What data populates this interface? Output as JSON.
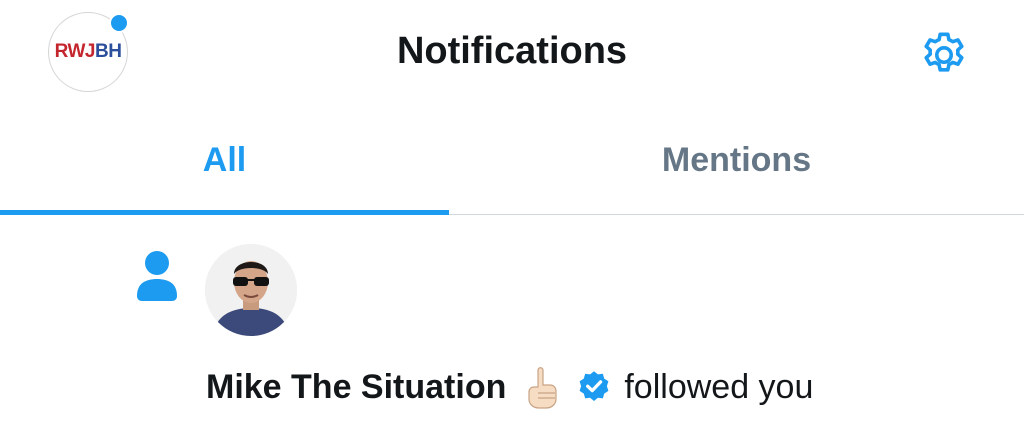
{
  "header": {
    "title": "Notifications",
    "profile_logo": {
      "part1": "RWJ",
      "part2": "BH"
    },
    "has_unread_indicator": true,
    "settings_icon": "gear-icon"
  },
  "tabs": [
    {
      "label": "All",
      "active": true
    },
    {
      "label": "Mentions",
      "active": false
    }
  ],
  "notifications": [
    {
      "type": "follow",
      "type_icon": "person-icon",
      "user_name": "Mike The Situation",
      "emoji": "index-pointing-up-emoji",
      "verified": true,
      "action_text": "followed you"
    }
  ],
  "colors": {
    "accent": "#1d9bf0",
    "text_primary": "#14171a",
    "text_secondary": "#657786",
    "divider": "#cfd9de",
    "logo_red": "#c4262e",
    "logo_blue": "#2b4f9c"
  }
}
